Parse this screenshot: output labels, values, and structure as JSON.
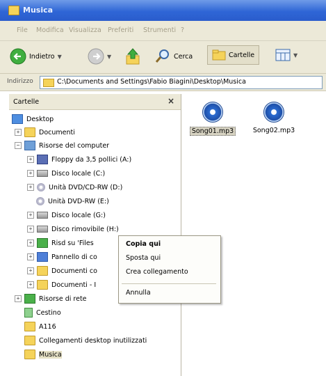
{
  "window": {
    "title": "Musica"
  },
  "menu": [
    "File",
    "Modifica",
    "Visualizza",
    "Preferiti",
    "Strumenti",
    "?"
  ],
  "toolbar": {
    "back_label": "Indietro",
    "search_label": "Cerca",
    "folders_label": "Cartelle"
  },
  "address": {
    "label": "Indirizzo",
    "value": "C:\\Documents and Settings\\Fabio Biagini\\Desktop\\Musica"
  },
  "folder_pane": {
    "title": "Cartelle",
    "close_glyph": "×",
    "items": [
      {
        "label": "Desktop",
        "icon": "desktop-icon"
      },
      {
        "label": "Documenti",
        "icon": "folder-icon",
        "expander": "+"
      },
      {
        "label": "Risorse del computer",
        "icon": "computer-icon",
        "expander": "−"
      },
      {
        "label": "Floppy da 3,5 pollici (A:)",
        "icon": "floppy-icon",
        "expander": "+"
      },
      {
        "label": "Disco locale (C:)",
        "icon": "drive-icon",
        "expander": "+"
      },
      {
        "label": "Unità DVD/CD-RW (D:)",
        "icon": "cd-icon",
        "expander": "+"
      },
      {
        "label": "Unità DVD-RW (E:)",
        "icon": "cd-icon"
      },
      {
        "label": "Disco locale (G:)",
        "icon": "drive-icon",
        "expander": "+"
      },
      {
        "label": "Disco rimovibile (H:)",
        "icon": "drive-icon",
        "expander": "+"
      },
      {
        "label": "Risd su 'Files",
        "icon": "network-drive-icon",
        "expander": "+"
      },
      {
        "label": "Pannello di co",
        "icon": "control-panel-icon",
        "expander": "+"
      },
      {
        "label": "Documenti co",
        "icon": "folder-icon",
        "expander": "+"
      },
      {
        "label": "Documenti - I",
        "icon": "folder-icon",
        "expander": "+"
      },
      {
        "label": "Risorse di rete",
        "icon": "network-icon",
        "expander": "+"
      },
      {
        "label": "Cestino",
        "icon": "recycle-bin-icon"
      },
      {
        "label": "A116",
        "icon": "folder-icon"
      },
      {
        "label": "Collegamenti desktop inutilizzati",
        "icon": "folder-icon"
      },
      {
        "label": "Musica",
        "icon": "folder-icon",
        "selected": true
      }
    ]
  },
  "files": [
    {
      "name": "Song01.mp3",
      "icon": "mp3-file-icon",
      "selected": true
    },
    {
      "name": "Song02.mp3",
      "icon": "mp3-file-icon"
    }
  ],
  "context_menu": {
    "items": [
      "Copia qui",
      "Sposta qui",
      "Crea collegamento",
      "Annulla"
    ]
  },
  "colors": {
    "title_bar": "#2f66d6",
    "chrome": "#ece9d8",
    "menu_disabled": "#a59f8a"
  }
}
